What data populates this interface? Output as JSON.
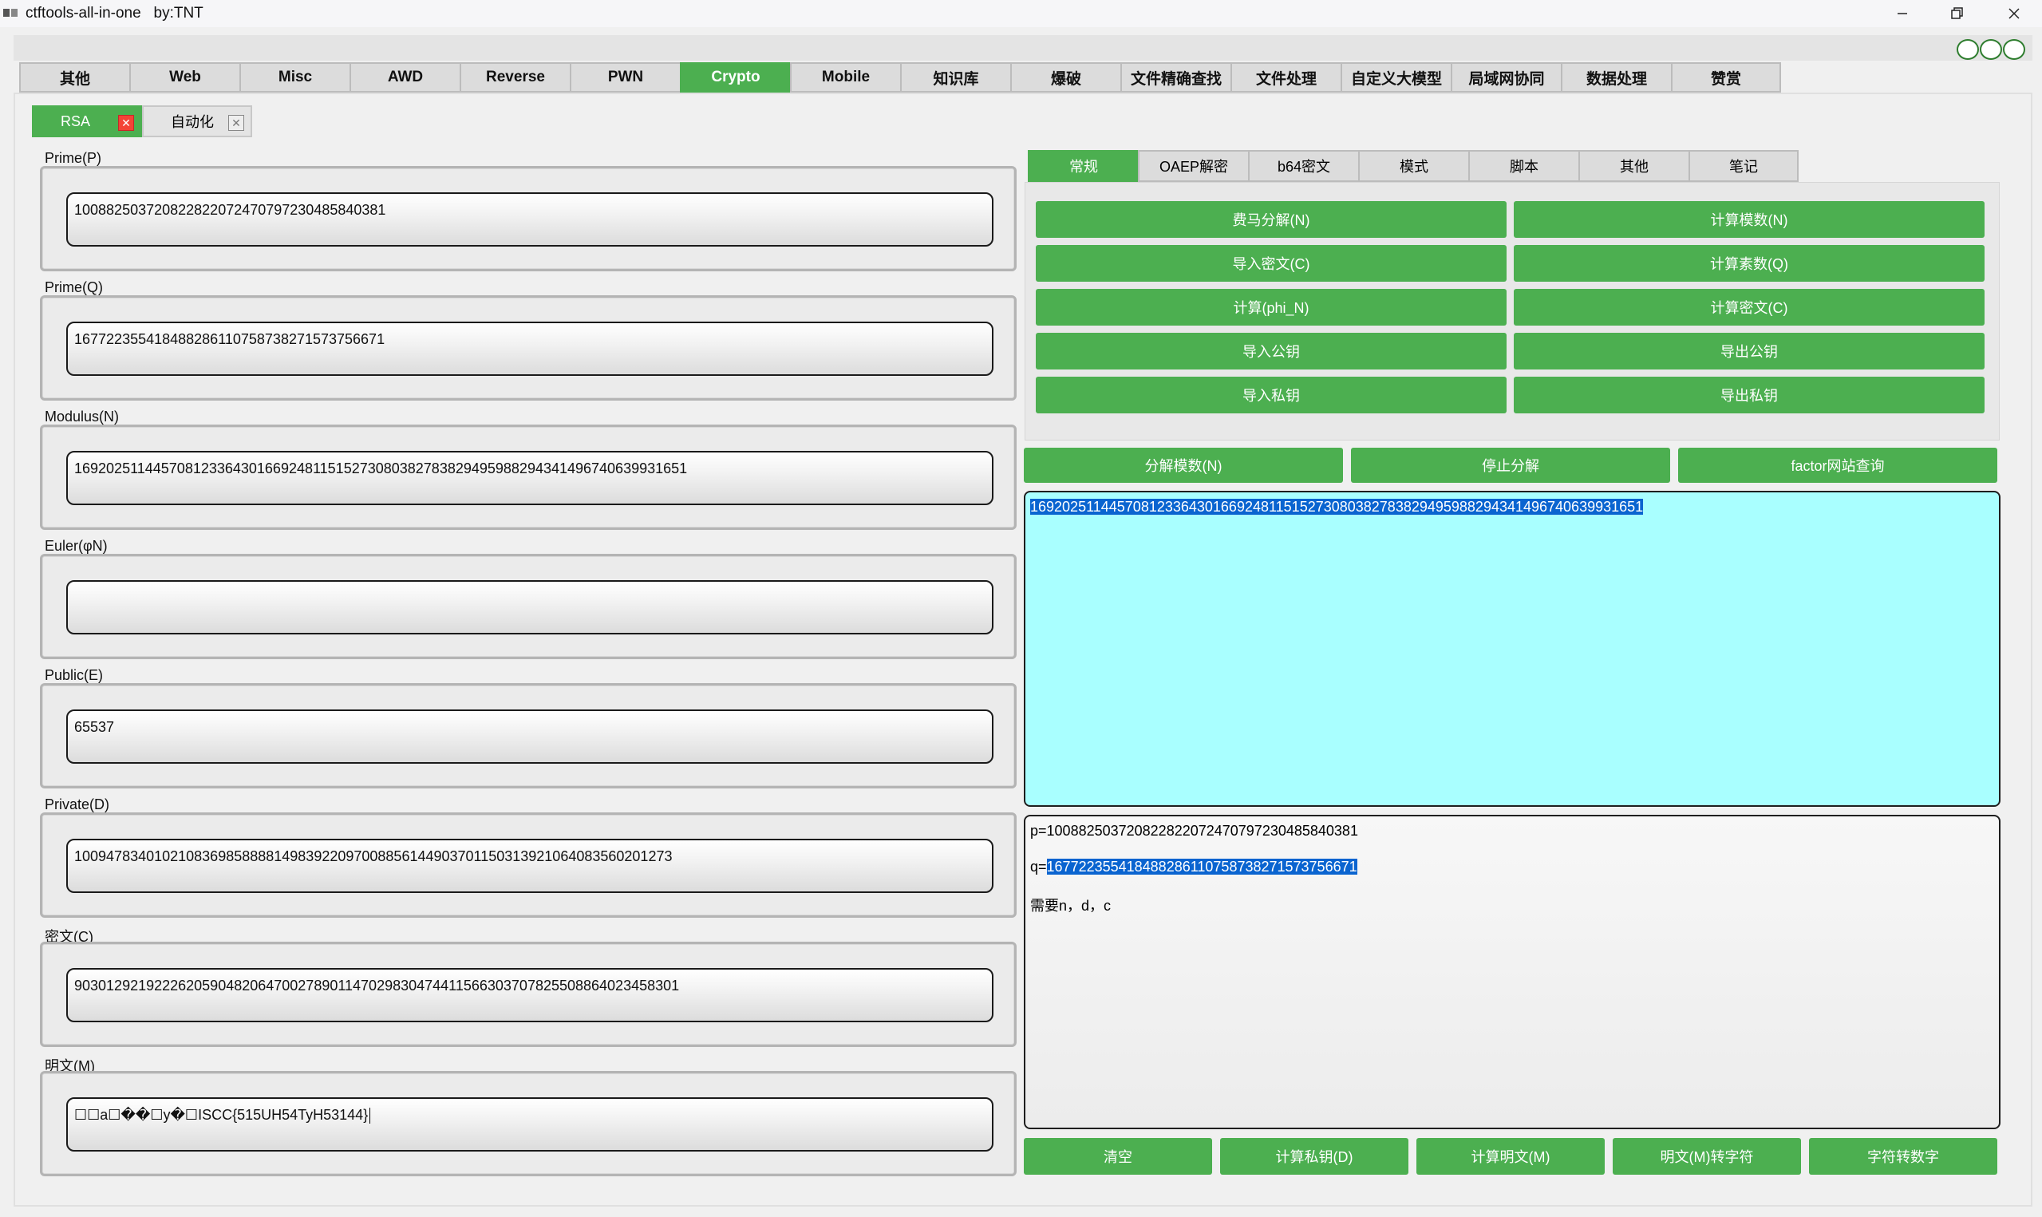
{
  "window": {
    "title": "ctftools-all-in-one   by:TNT"
  },
  "main_tabs": [
    "其他",
    "Web",
    "Misc",
    "AWD",
    "Reverse",
    "PWN",
    "Crypto",
    "Mobile",
    "知识库",
    "爆破",
    "文件精确查找",
    "文件处理",
    "自定义大模型",
    "局域网协同",
    "数据处理",
    "赞赏"
  ],
  "main_tabs_active": "Crypto",
  "sub_tabs": [
    {
      "label": "RSA",
      "active": true
    },
    {
      "label": "自动化",
      "active": false
    }
  ],
  "fields": {
    "p": {
      "label": "Prime(P)",
      "value": "100882503720822822072470797230485840381"
    },
    "q": {
      "label": "Prime(Q)",
      "value": "167722355418488286110758738271573756671"
    },
    "n": {
      "label": "Modulus(N)",
      "value": "16920251144570812336430166924811515273080382783829495988294341496740639931651"
    },
    "phi": {
      "label": "Euler(φN)",
      "value": ""
    },
    "e": {
      "label": "Public(E)",
      "value": "65537"
    },
    "d": {
      "label": "Private(D)",
      "value": "10094783401021083698588881498392209700885614490370115031392106408356020127​3"
    },
    "c": {
      "label": "密文(C)",
      "value": "90301292192226205904820647002789011470298304744115663037078255088640234583​01"
    },
    "m": {
      "label": "明文(M)",
      "value": "☐☐a☐��☐y�☐ISCC{515UH54TyH53144}"
    }
  },
  "right_tabs": [
    "常规",
    "OAEP解密",
    "b64密文",
    "模式",
    "脚本",
    "其他",
    "笔记"
  ],
  "right_tabs_active": "常规",
  "panel_buttons": {
    "left": [
      "费马分解(N)",
      "导入密文(C)",
      "计算(phi_N)",
      "导入公钥",
      "导入私钥"
    ],
    "right": [
      "计算模数(N)",
      "计算素数(Q)",
      "计算密文(C)",
      "导出公钥",
      "导出私钥"
    ]
  },
  "factor_buttons": [
    "分解模数(N)",
    "停止分解",
    "factor网站查询"
  ],
  "factor_output": "16920251144570812336430166924811515273080382783829495988294341496740639931651",
  "log": {
    "p_prefix": "p=",
    "p_value": "100882503720822822072470797230485840381",
    "q_prefix": "q=",
    "q_value": "167722355418488286110758738271573756671",
    "note": "需要n，d，c"
  },
  "bottom_buttons": [
    "清空",
    "计算私钥(D)",
    "计算明文(M)",
    "明文(M)转字符",
    "字符转数字"
  ],
  "colors": {
    "accent_green": "#4caf50",
    "factor_output_bg": "#a9ffff",
    "selection": "#0a64d0",
    "close_red": "#f44336"
  }
}
